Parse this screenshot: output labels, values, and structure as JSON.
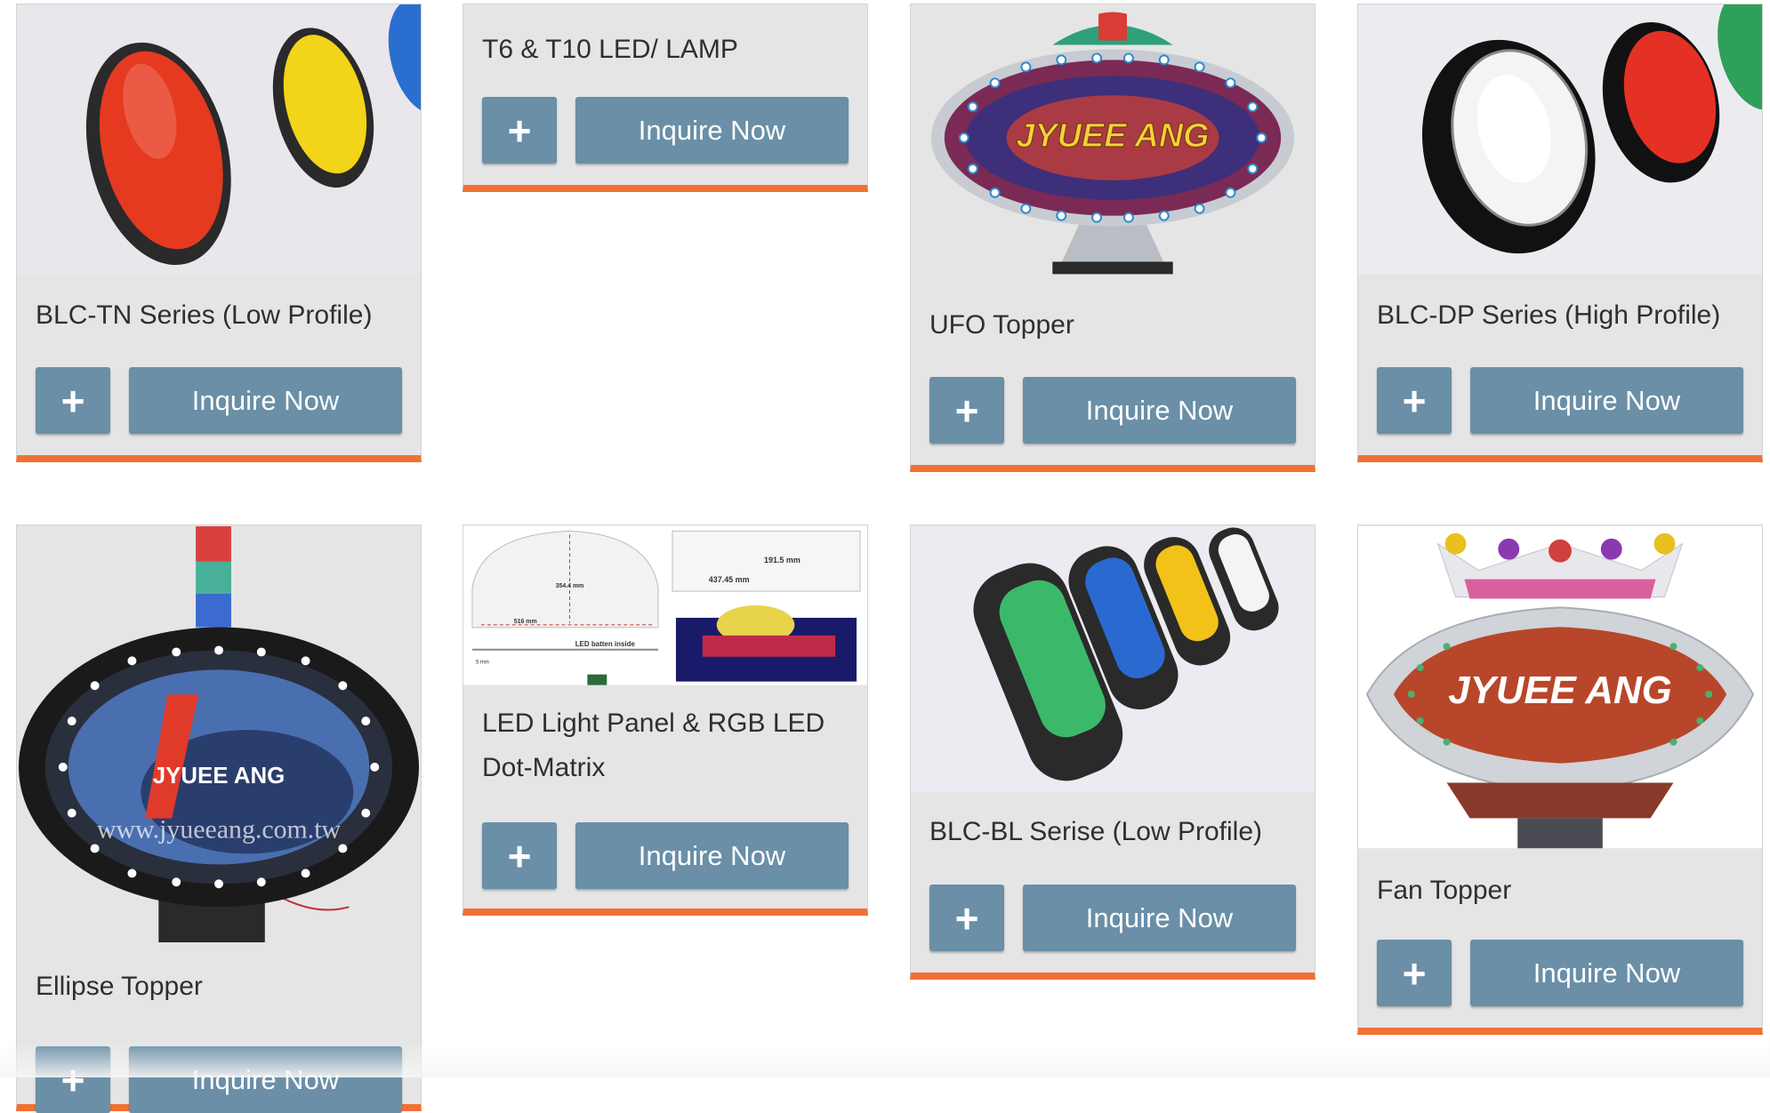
{
  "products": [
    {
      "title": "BLC-TN Series (Low Profile)"
    },
    {
      "title": "T6 & T10 LED/ LAMP"
    },
    {
      "title": "UFO Topper"
    },
    {
      "title": "BLC-DP Series (High Profile)"
    },
    {
      "title": "Ellipse Topper"
    },
    {
      "title": "LED Light Panel & RGB LED Dot-Matrix"
    },
    {
      "title": "BLC-BL Serise (Low Profile)"
    },
    {
      "title": "Fan Topper"
    }
  ],
  "buttons": {
    "plus": "+",
    "inquire": "Inquire Now"
  },
  "images": {
    "jyuee_brand": "JYUEE ANG",
    "ellipse_brand": "JYUEE ANG",
    "ellipse_watermark": "www.jyueeang.com.tw",
    "fan_brand": "JYUEE ANG",
    "panel": {
      "dim1": "354.4 mm",
      "dim2": "516 mm",
      "dim3": "191.5 mm",
      "dim4": "437.45 mm",
      "dim5": "LED batten inside",
      "dim6": "5 mm"
    }
  },
  "colors": {
    "button": "#6a8fa7",
    "accent": "#f07232",
    "card": "#e5e5e5"
  }
}
